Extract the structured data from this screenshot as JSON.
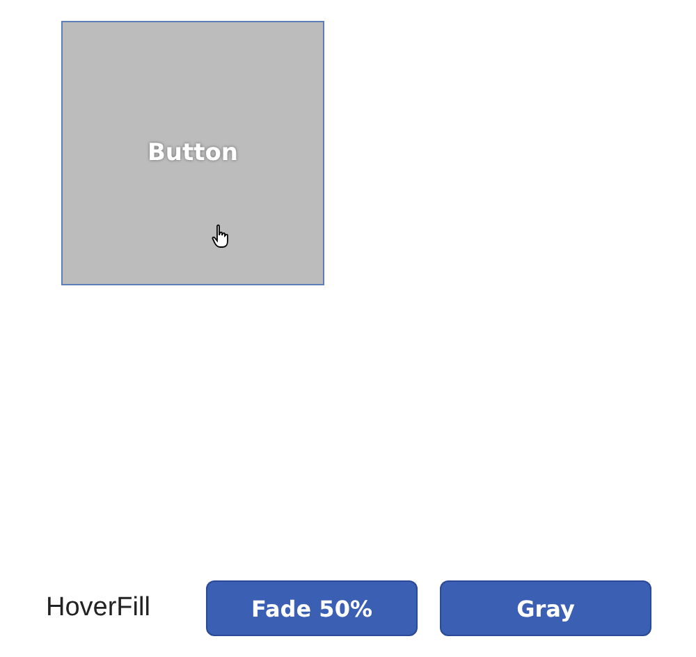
{
  "demo_button": {
    "label": "Button",
    "hovered": true
  },
  "option_row": {
    "label": "HoverFill",
    "buttons": [
      {
        "label": "Fade 50%"
      },
      {
        "label": "Gray"
      }
    ]
  }
}
